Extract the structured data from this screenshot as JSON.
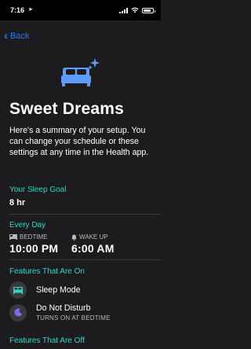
{
  "status_bar": {
    "time": "7:16"
  },
  "nav": {
    "back_label": "Back"
  },
  "page": {
    "title": "Sweet Dreams",
    "summary": "Here's a summary of your setup. You can change your schedule or these settings at any time in the Health app."
  },
  "sleep_goal": {
    "label": "Your Sleep Goal",
    "value": "8 hr"
  },
  "schedule": {
    "label": "Every Day",
    "bedtime_label": "BEDTIME",
    "bedtime_value": "10:00 PM",
    "wakeup_label": "WAKE UP",
    "wakeup_value": "6:00 AM"
  },
  "features_on": {
    "label": "Features That Are On",
    "items": [
      {
        "name": "Sleep Mode",
        "icon": "bed-icon"
      },
      {
        "name": "Do Not Disturb",
        "subtitle": "TURNS ON AT BEDTIME",
        "icon": "moon-icon"
      }
    ]
  },
  "features_off": {
    "label": "Features That Are Off"
  },
  "colors": {
    "accent": "#30d5c8",
    "link": "#0a84ff",
    "icon_blue": "#5e9cf7",
    "background": "#1c1c1e"
  }
}
